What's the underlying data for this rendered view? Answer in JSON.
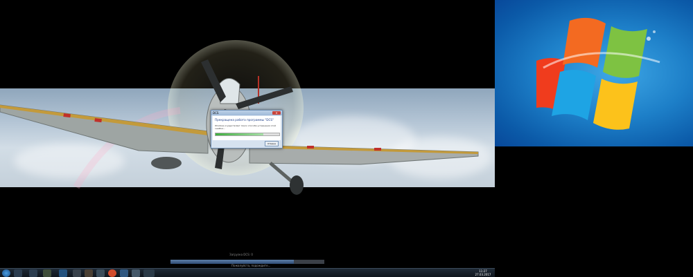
{
  "dialog": {
    "app": "DCS",
    "heading": "Прекращена работа программы \"DCS\"",
    "message": "Windows осуществляет поиск способа устранения этой ошибки...",
    "button": "Отмена",
    "progress": 0.75
  },
  "loader": {
    "status": "Загрузка DCS: 0",
    "hint": "Пожалуйста, подождите...",
    "progress": 0.8
  },
  "taskbar": {
    "icons": [
      "start-orb-icon",
      "windows-icon",
      "explorer-icon",
      "media-icon",
      "dcs-icon",
      "steam-icon",
      "chrome-icon",
      "browser-icon",
      "app-icon",
      "folder-icon"
    ],
    "clock": {
      "time": "11:27",
      "date": "27.03.2017"
    }
  }
}
